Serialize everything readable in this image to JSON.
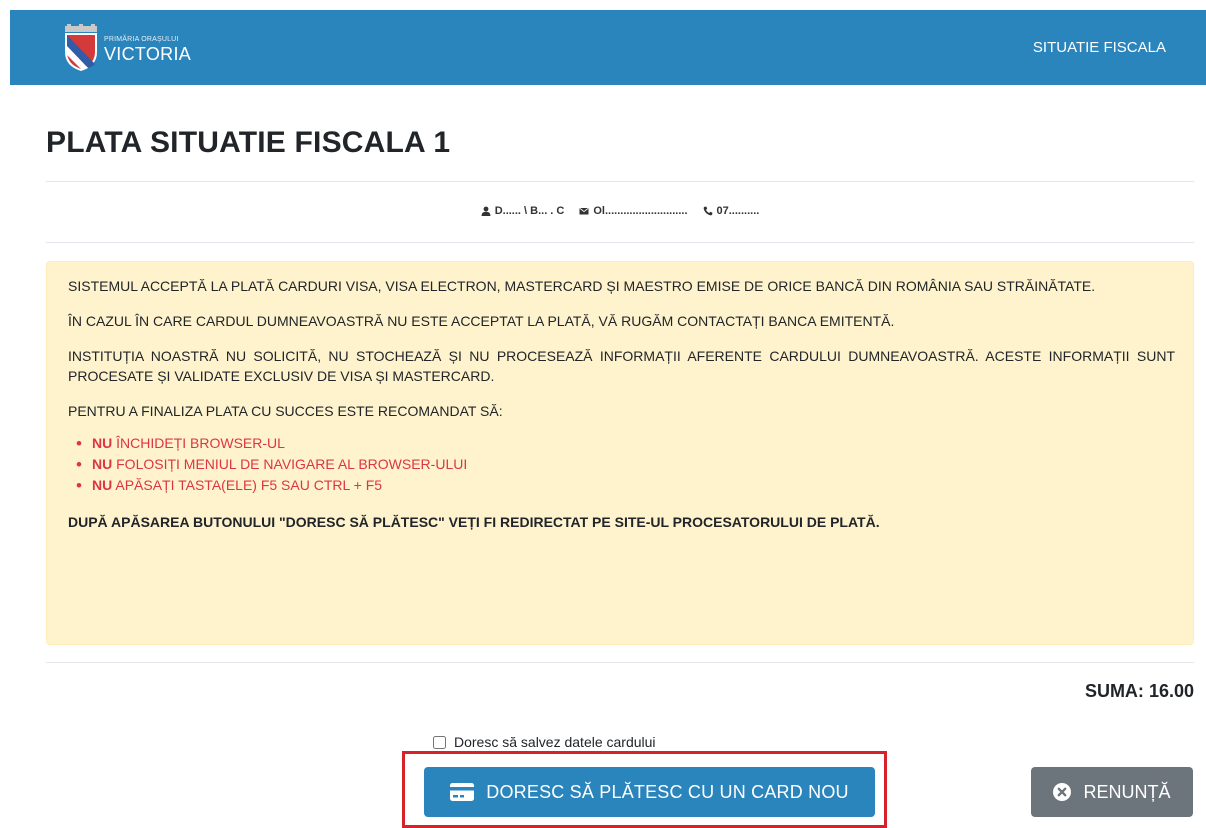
{
  "header": {
    "brand_top": "PRIMĂRIA ORAȘULUI",
    "brand_name": "VICTORIA",
    "crest_icon": "city-crest-logo",
    "nav_link": "SITUATIE FISCALA"
  },
  "page": {
    "title": "PLATA SITUATIE FISCALA 1!"
  },
  "contact": {
    "name": "D...... \\ B... . C",
    "email": "Ol...........................",
    "phone": "07..........",
    "icons": [
      "user-icon",
      "envelope-icon",
      "phone-icon"
    ]
  },
  "notice": {
    "para1": "SISTEMUL ACCEPTĂ LA PLATĂ CARDURI VISA, VISA ELECTRON, MASTERCARD ȘI MAESTRO EMISE DE ORICE BANCĂ DIN ROMÂNIA SAU STRĂINĂTATE.",
    "para2": "ÎN CAZUL ÎN CARE CARDUL DUMNEAVOASTRĂ NU ESTE ACCEPTAT LA PLATĂ, VĂ RUGĂM CONTACTAȚI BANCA EMITENTĂ.",
    "para3": "INSTITUȚIA NOASTRĂ NU SOLICITĂ, NU STOCHEAZĂ ȘI NU PROCESEAZĂ INFORMAȚII AFERENTE CARDULUI DUMNEAVOASTRĂ. ACESTE INFORMAȚII SUNT PROCESATE ȘI VALIDATE EXCLUSIV DE VISA ȘI MASTERCARD.",
    "para4": "PENTRU A FINALIZA PLATA CU SUCCES ESTE RECOMANDAT SĂ:",
    "items": [
      {
        "bold": "NU",
        "text": " ÎNCHIDEȚI BROWSER-UL"
      },
      {
        "bold": "NU",
        "text": " FOLOSIȚI MENIUL DE NAVIGARE AL BROWSER-ULUI"
      },
      {
        "bold": "NU",
        "text": " APĂSAȚI TASTA(ELE) F5 SAU CTRL + F5"
      }
    ],
    "final": "DUPĂ APĂSAREA BUTONULUI \"DORESC SĂ PLĂTESC\" VEȚI FI REDIRECTAT PE SITE-UL PROCESATORULUI DE PLATĂ."
  },
  "summary": {
    "label": "SUMA:",
    "amount": "16.00"
  },
  "form": {
    "save_card_label": "Doresc să salvez datele cardului",
    "save_card_checked": false
  },
  "actions": {
    "pay_label": "DORESC SĂ PLĂTESC CU UN CARD NOU",
    "pay_icon": "credit-card-icon",
    "cancel_label": "RENUNȚĂ",
    "cancel_icon": "times-circle-icon"
  },
  "colors": {
    "primary": "#2a85bd",
    "secondary": "#6d757c",
    "warning_bg": "#fff3cd",
    "danger": "#dc3545",
    "highlight": "#d72229"
  }
}
